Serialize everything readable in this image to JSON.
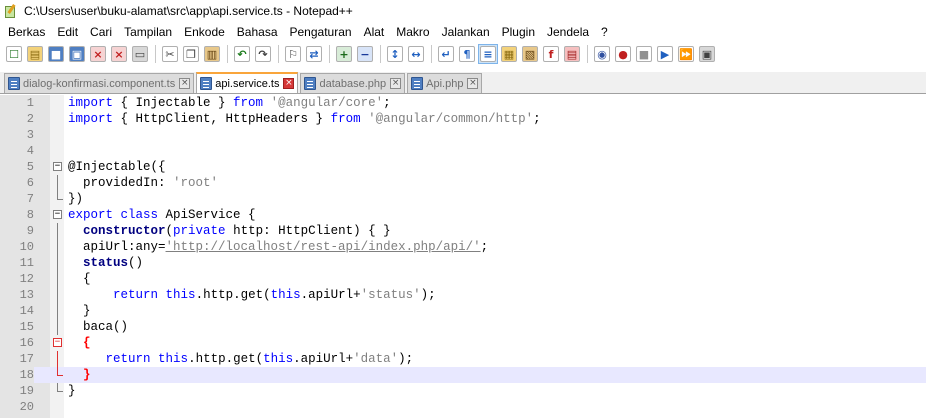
{
  "window": {
    "title": "C:\\Users\\user\\buku-alamat\\src\\app\\api.service.ts - Notepad++"
  },
  "menu": [
    "Berkas",
    "Edit",
    "Cari",
    "Tampilan",
    "Enkode",
    "Bahasa",
    "Pengaturan",
    "Alat",
    "Makro",
    "Jalankan",
    "Plugin",
    "Jendela",
    "?"
  ],
  "toolbar": {
    "icons": [
      "new-file-icon",
      "open-file-icon",
      "save-icon",
      "save-all-icon",
      "close-icon",
      "close-all-icon",
      "print-icon",
      "cut-icon",
      "copy-icon",
      "paste-icon",
      "undo-icon",
      "redo-icon",
      "find-icon",
      "replace-icon",
      "zoom-in-icon",
      "zoom-out-icon",
      "sync-vertical-icon",
      "sync-horizontal-icon",
      "word-wrap-icon",
      "show-all-chars-icon",
      "indent-guide-icon",
      "define-language-icon",
      "doc-map-icon",
      "function-list-icon",
      "folder-as-workspace-icon",
      "monitoring-icon",
      "record-macro-icon",
      "stop-record-icon",
      "play-macro-icon",
      "run-macro-multiple-icon",
      "save-macro-icon"
    ]
  },
  "tabs": [
    {
      "label": "dialog-konfirmasi.component.ts",
      "active": false
    },
    {
      "label": "api.service.ts",
      "active": true
    },
    {
      "label": "database.php",
      "active": false
    },
    {
      "label": "Api.php",
      "active": false
    }
  ],
  "editor": {
    "current_line": 18,
    "lines": [
      {
        "n": "1",
        "tokens": [
          [
            "kw",
            "import"
          ],
          [
            "plain",
            " { Injectable } "
          ],
          [
            "kw",
            "from"
          ],
          [
            "plain",
            " "
          ],
          [
            "str",
            "'@angular/core'"
          ],
          [
            "plain",
            ";"
          ]
        ]
      },
      {
        "n": "2",
        "tokens": [
          [
            "kw",
            "import"
          ],
          [
            "plain",
            " { HttpClient, HttpHeaders } "
          ],
          [
            "kw",
            "from"
          ],
          [
            "plain",
            " "
          ],
          [
            "str",
            "'@angular/common/http'"
          ],
          [
            "plain",
            ";"
          ]
        ]
      },
      {
        "n": "3",
        "tokens": []
      },
      {
        "n": "4",
        "tokens": []
      },
      {
        "n": "5",
        "tokens": [
          [
            "plain",
            "@Injectable({"
          ]
        ]
      },
      {
        "n": "6",
        "tokens": [
          [
            "plain",
            "  providedIn: "
          ],
          [
            "str",
            "'root'"
          ]
        ]
      },
      {
        "n": "7",
        "tokens": [
          [
            "plain",
            "})"
          ]
        ]
      },
      {
        "n": "8",
        "tokens": [
          [
            "kw",
            "export"
          ],
          [
            "plain",
            " "
          ],
          [
            "kw",
            "class"
          ],
          [
            "plain",
            " ApiService {"
          ]
        ]
      },
      {
        "n": "9",
        "tokens": [
          [
            "plain",
            "  "
          ],
          [
            "kw-b",
            "constructor"
          ],
          [
            "plain",
            "("
          ],
          [
            "kw",
            "private"
          ],
          [
            "plain",
            " http: HttpClient) { }"
          ]
        ]
      },
      {
        "n": "10",
        "tokens": [
          [
            "plain",
            "  apiUrl:any="
          ],
          [
            "url",
            "'http://localhost/rest-api/index.php/api/'"
          ],
          [
            "plain",
            ";"
          ]
        ]
      },
      {
        "n": "11",
        "tokens": [
          [
            "plain",
            "  "
          ],
          [
            "kw-b",
            "status"
          ],
          [
            "plain",
            "()"
          ]
        ]
      },
      {
        "n": "12",
        "tokens": [
          [
            "plain",
            "  {"
          ]
        ]
      },
      {
        "n": "13",
        "tokens": [
          [
            "plain",
            "      "
          ],
          [
            "kw",
            "return"
          ],
          [
            "plain",
            " "
          ],
          [
            "kw",
            "this"
          ],
          [
            "plain",
            ".http.get("
          ],
          [
            "kw",
            "this"
          ],
          [
            "plain",
            ".apiUrl+"
          ],
          [
            "str",
            "'status'"
          ],
          [
            "plain",
            ");"
          ]
        ]
      },
      {
        "n": "14",
        "tokens": [
          [
            "plain",
            "  }"
          ]
        ]
      },
      {
        "n": "15",
        "tokens": [
          [
            "plain",
            "  baca()"
          ]
        ]
      },
      {
        "n": "16",
        "tokens": [
          [
            "plain",
            "  "
          ],
          [
            "brace-red",
            "{"
          ]
        ]
      },
      {
        "n": "17",
        "tokens": [
          [
            "plain",
            "     "
          ],
          [
            "kw",
            "return"
          ],
          [
            "plain",
            " "
          ],
          [
            "kw",
            "this"
          ],
          [
            "plain",
            ".http.get("
          ],
          [
            "kw",
            "this"
          ],
          [
            "plain",
            ".apiUrl+"
          ],
          [
            "str",
            "'data'"
          ],
          [
            "plain",
            ");"
          ]
        ]
      },
      {
        "n": "18",
        "tokens": [
          [
            "plain",
            "  "
          ],
          [
            "brace-red",
            "}"
          ]
        ]
      },
      {
        "n": "19",
        "tokens": [
          [
            "plain",
            "}"
          ]
        ]
      },
      {
        "n": "20",
        "tokens": []
      }
    ]
  }
}
